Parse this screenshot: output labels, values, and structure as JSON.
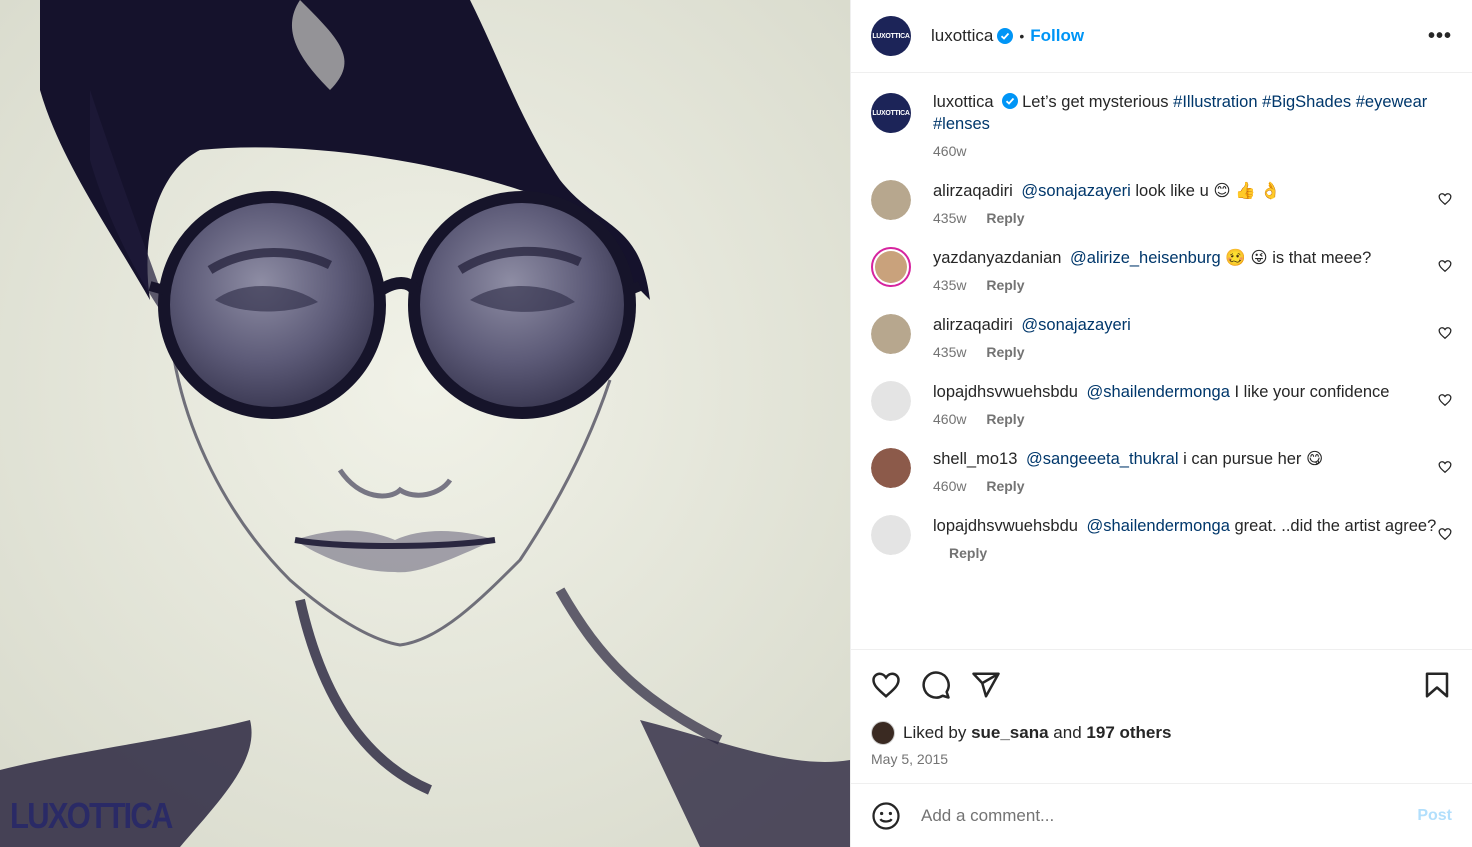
{
  "post": {
    "brand_mark": "LUXOTTICA",
    "author": "luxottica",
    "author_avatar_text": "LUXOTTICA",
    "follow_label": "Follow",
    "separator": "•",
    "more_label": "•••",
    "caption": {
      "user": "luxottica",
      "text": "Let’s get mysterious",
      "hashtags": [
        "#Illustration",
        "#BigShades",
        "#eyewear",
        "#lenses"
      ],
      "time": "460w"
    },
    "reply_label": "Reply",
    "comments": [
      {
        "user": "alirzaqadiri",
        "mention": "@sonajazayeri",
        "text": "look like u 😊 👍 👌",
        "time": "435w",
        "avatar_color": "#b7a78e",
        "ring": false
      },
      {
        "user": "yazdanyazdanian",
        "mention": "@alirize_heisenburg",
        "text": "🥴 😜  is that meee?",
        "time": "435w",
        "avatar_color": "#c9a27c",
        "ring": true
      },
      {
        "user": "alirzaqadiri",
        "mention": "@sonajazayeri",
        "text": "",
        "time": "435w",
        "avatar_color": "#b7a78e",
        "ring": false
      },
      {
        "user": "lopajdhsvwuehsbdu",
        "mention": "@shailendermonga",
        "text": "I like your confidence",
        "time": "460w",
        "avatar_color": "#e4e4e4",
        "ring": false
      },
      {
        "user": "shell_mo13",
        "mention": "@sangeeeta_thukral",
        "text": "i can pursue her 😋",
        "time": "460w",
        "avatar_color": "#8c5a4a",
        "ring": false
      },
      {
        "user": "lopajdhsvwuehsbdu",
        "mention": "@shailendermonga",
        "text": "great. ..did the artist agree?",
        "time": "",
        "avatar_color": "#e4e4e4",
        "ring": false
      }
    ],
    "likes": {
      "prefix": "Liked by",
      "user": "sue_sana",
      "middle": "and",
      "others": "197 others"
    },
    "date": "May 5, 2015",
    "add_comment_placeholder": "Add a comment...",
    "post_label": "Post"
  },
  "icons": {
    "heart": "heart-icon",
    "comment": "comment-icon",
    "share": "share-icon",
    "save": "bookmark-icon",
    "emoji": "emoji-icon",
    "verified": "verified-badge-icon"
  },
  "colors": {
    "link": "#00376b",
    "follow": "#0095f6",
    "muted": "#737373",
    "brand": "#1c2458"
  }
}
